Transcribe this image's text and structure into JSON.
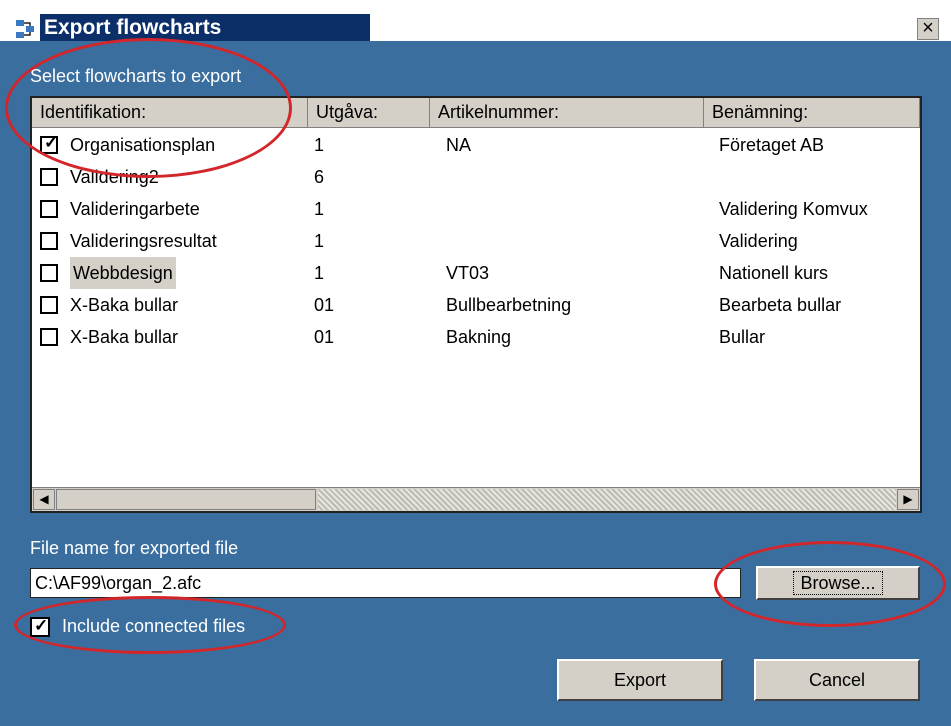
{
  "window": {
    "title": "Export flowcharts",
    "close_glyph": "×"
  },
  "list_section_label": "Select flowcharts to export",
  "columns": [
    "Identifikation:",
    "Utgåva:",
    "Artikelnummer:",
    "Benämning:"
  ],
  "rows": [
    {
      "checked": true,
      "id": "Organisationsplan",
      "utgava": "1",
      "artikel": "NA",
      "benamning": "Företaget AB"
    },
    {
      "checked": false,
      "id": "Validering2",
      "utgava": "6",
      "artikel": "",
      "benamning": ""
    },
    {
      "checked": false,
      "id": "Valideringarbete",
      "utgava": "1",
      "artikel": "",
      "benamning": "Validering Komvux"
    },
    {
      "checked": false,
      "id": "Valideringsresultat",
      "utgava": "1",
      "artikel": "",
      "benamning": "Validering"
    },
    {
      "checked": false,
      "id": "Webbdesign",
      "utgava": "1",
      "artikel": "VT03",
      "benamning": "Nationell kurs",
      "selected": true
    },
    {
      "checked": false,
      "id": "X-Baka bullar",
      "utgava": "01",
      "artikel": "Bullbearbetning",
      "benamning": "Bearbeta bullar"
    },
    {
      "checked": false,
      "id": "X-Baka bullar",
      "utgava": "01",
      "artikel": "Bakning",
      "benamning": "Bullar"
    }
  ],
  "file_section_label": "File name for exported file",
  "file_name_value": "C:\\AF99\\organ_2.afc",
  "browse_label": "Browse...",
  "include_connected": {
    "label": "Include connected files",
    "checked": true
  },
  "export_label": "Export",
  "cancel_label": "Cancel",
  "check_glyph": "✓",
  "colors": {
    "dialog_bg": "#3a6e9f",
    "titlebar": "#0c2f6a",
    "annotation": "#d3262a"
  }
}
